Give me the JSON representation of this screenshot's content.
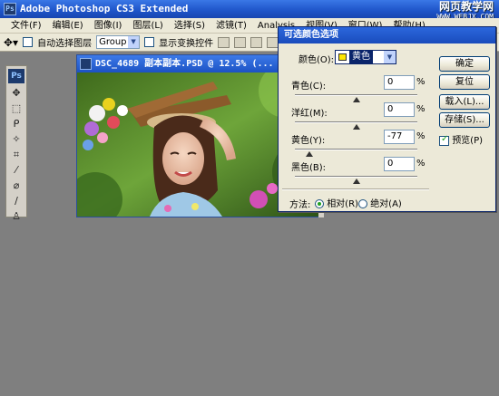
{
  "app": {
    "title": "Adobe Photoshop CS3 Extended",
    "watermark_line1": "网页教学网",
    "watermark_line2": "WWW.WEBJX.COM"
  },
  "menu": [
    "文件(F)",
    "编辑(E)",
    "图像(I)",
    "图层(L)",
    "选择(S)",
    "滤镜(T)",
    "Analysis",
    "视图(V)",
    "窗口(W)",
    "帮助(H)"
  ],
  "options": {
    "auto_select_label": "自动选择图层",
    "auto_select_value": "Group",
    "show_transform_label": "显示变换控件"
  },
  "document": {
    "title": "DSC_4689 副本副本.PSD @ 12.5% (..."
  },
  "dialog": {
    "title": "可选颜色选项",
    "color_label": "颜色(O):",
    "color_value": "黄色",
    "sliders": [
      {
        "label": "青色(C):",
        "value": "0",
        "fraction": 0.5
      },
      {
        "label": "洋红(M):",
        "value": "0",
        "fraction": 0.5
      },
      {
        "label": "黄色(Y):",
        "value": "-77",
        "fraction": 0.115
      },
      {
        "label": "黑色(B):",
        "value": "0",
        "fraction": 0.5
      }
    ],
    "percent": "%",
    "method_label": "方法:",
    "method_relative": "相对(R)",
    "method_absolute": "绝对(A)",
    "buttons": {
      "ok": "确定",
      "reset": "复位",
      "load": "载入(L)...",
      "save": "存储(S)...",
      "preview": "预览(P)"
    }
  },
  "colors": {
    "titlebar": "#1e54c8",
    "chrome": "#ece9d8",
    "workspace": "#7f7f7f",
    "swatch_yellow": "#ffe600"
  }
}
